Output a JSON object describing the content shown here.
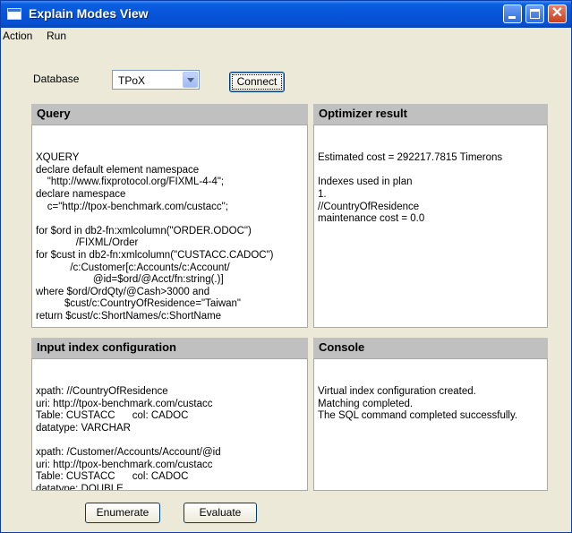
{
  "window": {
    "title": "Explain Modes View",
    "controls": [
      "minimize",
      "maximize",
      "close"
    ]
  },
  "menubar": {
    "items": [
      "Action",
      "Run"
    ]
  },
  "toolbar": {
    "database_label": "Database",
    "database_selected": "TPoX",
    "connect_label": "Connect"
  },
  "query": {
    "title": "Query",
    "lines": [
      "XQUERY",
      "declare default element namespace",
      "    \"http://www.fixprotocol.org/FIXML-4-4\";",
      "declare namespace",
      "    c=\"http://tpox-benchmark.com/custacc\";",
      "",
      "for $ord in db2-fn:xmlcolumn(\"ORDER.ODOC\")",
      "              /FIXML/Order",
      "for $cust in db2-fn:xmlcolumn(\"CUSTACC.CADOC\")",
      "            /c:Customer[c:Accounts/c:Account/",
      "                    @id=$ord/@Acct/fn:string(.)]",
      "where $ord/OrdQty/@Cash>3000 and",
      "          $cust/c:CountryOfResidence=\"Taiwan\"",
      "return $cust/c:ShortNames/c:ShortName"
    ]
  },
  "optimizer": {
    "title": "Optimizer result",
    "lines": [
      "Estimated cost = 292217.7815 Timerons",
      "",
      "Indexes used in plan",
      "1.",
      "//CountryOfResidence",
      "maintenance cost = 0.0"
    ]
  },
  "input_index": {
    "title": "Input index configuration",
    "lines": [
      "xpath: //CountryOfResidence",
      "uri: http://tpox-benchmark.com/custacc",
      "Table: CUSTACC      col: CADOC",
      "datatype: VARCHAR",
      "",
      "xpath: /Customer/Accounts/Account/@id",
      "uri: http://tpox-benchmark.com/custacc",
      "Table: CUSTACC      col: CADOC",
      "datatype: DOUBLE"
    ]
  },
  "console": {
    "title": "Console",
    "lines": [
      "Virtual index configuration created.",
      "Matching completed.",
      "The SQL command completed successfully."
    ]
  },
  "actions": {
    "enumerate_label": "Enumerate",
    "evaluate_label": "Evaluate"
  }
}
